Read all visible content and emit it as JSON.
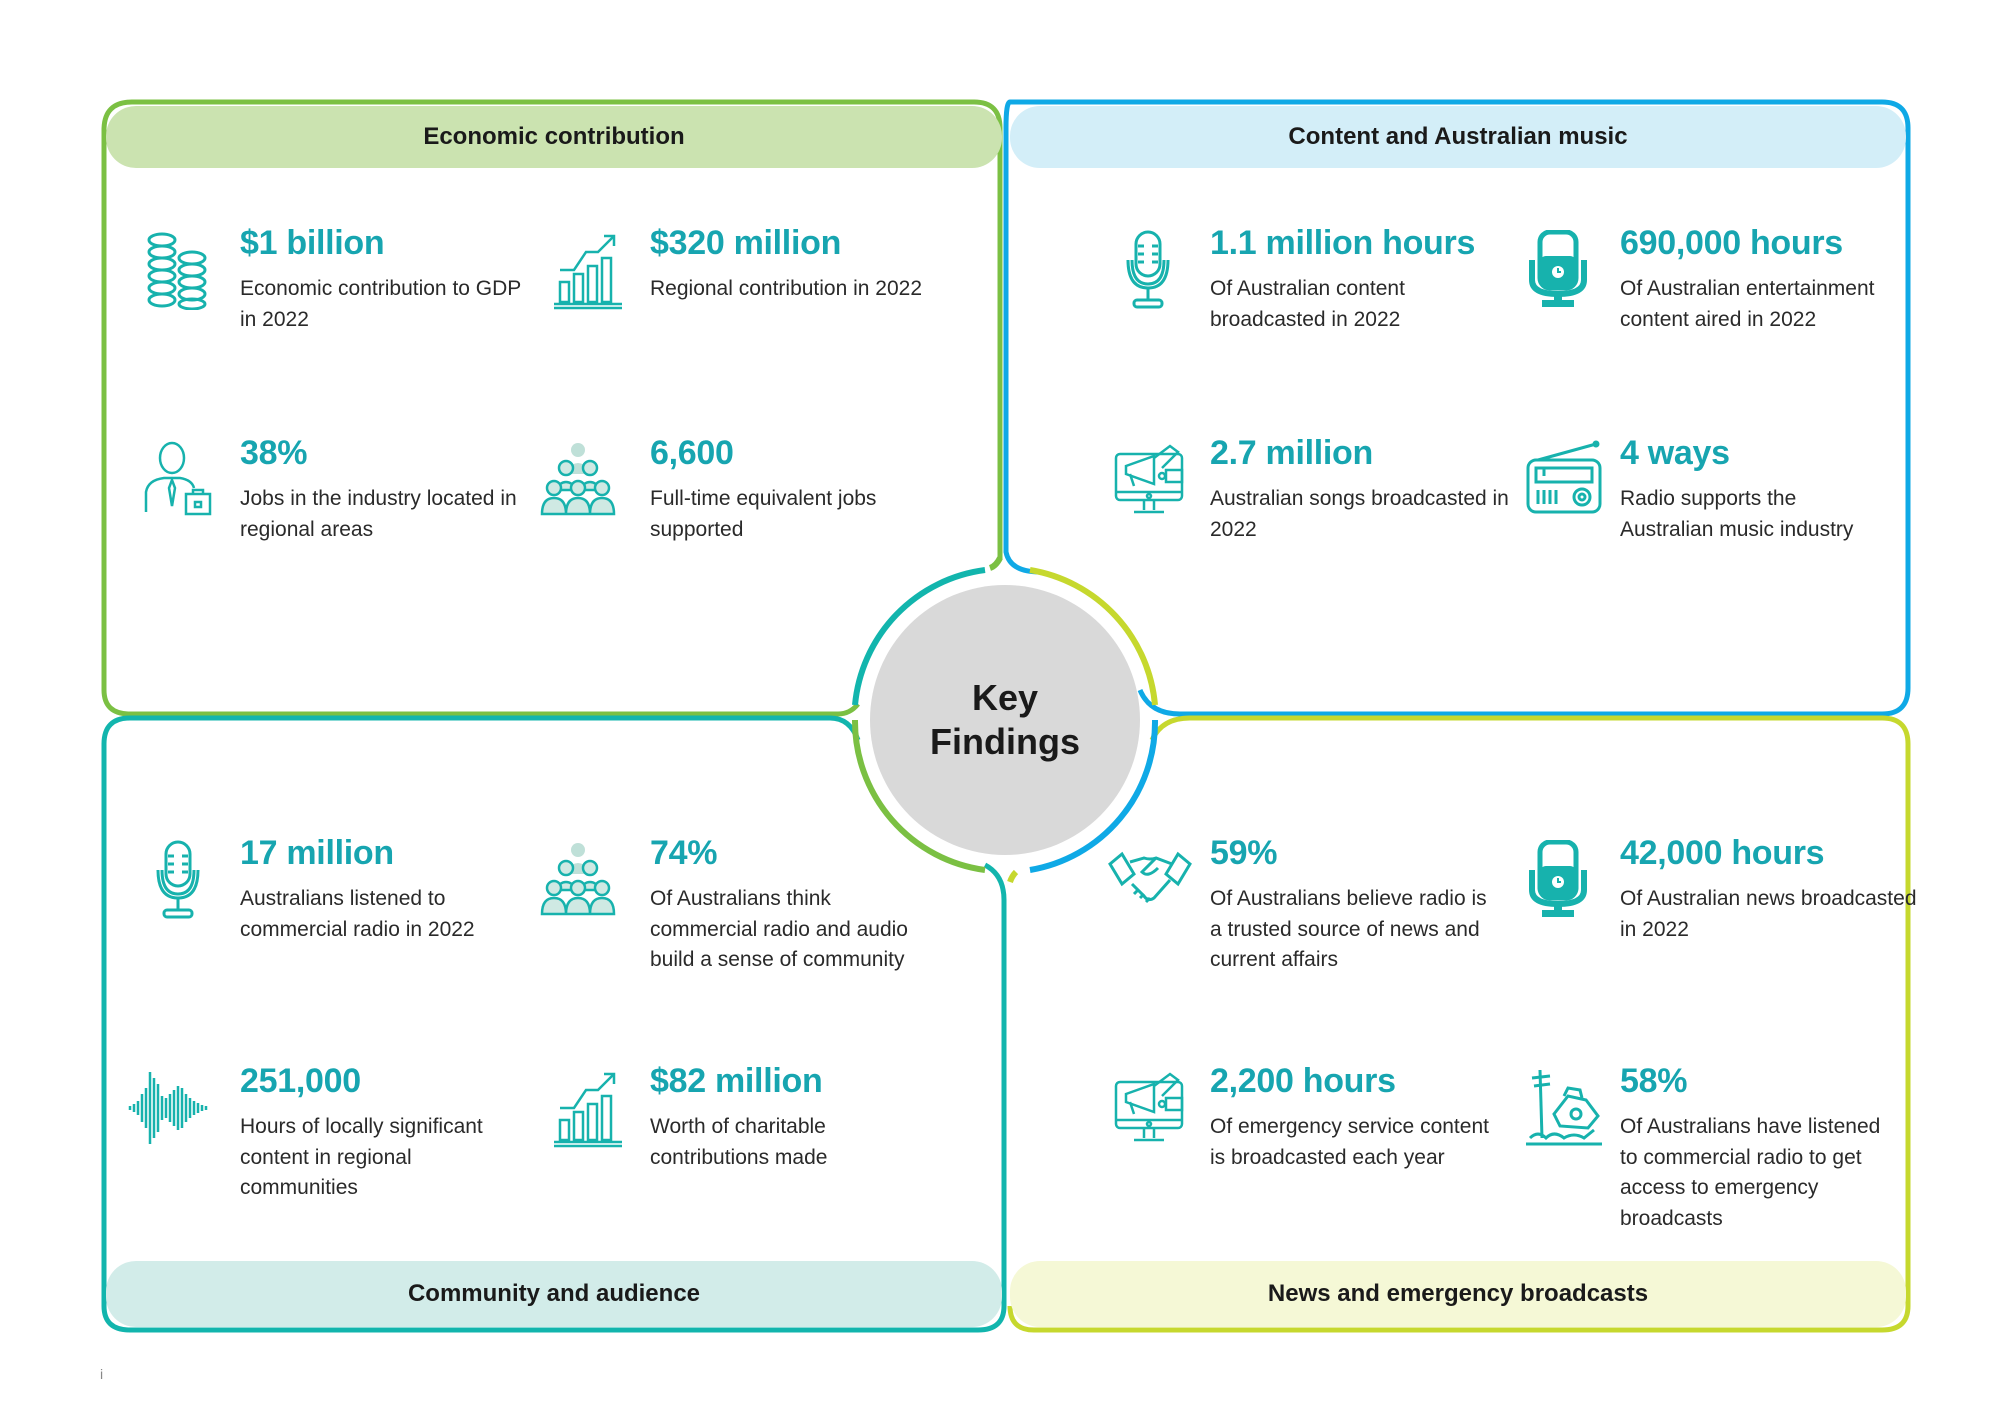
{
  "center": {
    "line1": "Key",
    "line2": "Findings"
  },
  "colors": {
    "economic": "#7bc043",
    "content": "#0fa9e6",
    "community": "#12b5ad",
    "news": "#c6d82e",
    "accent_text": "#17a5b0"
  },
  "sections": {
    "economic": {
      "title": "Economic contribution",
      "stats": [
        {
          "icon": "coins-stack-icon",
          "value": "$1 billion",
          "desc": "Economic contribution to GDP in 2022"
        },
        {
          "icon": "growth-chart-icon",
          "value": "$320 million",
          "desc": "Regional contribution in 2022"
        },
        {
          "icon": "businessman-icon",
          "value": "38%",
          "desc": "Jobs in the industry located in regional areas"
        },
        {
          "icon": "people-group-icon",
          "value": "6,600",
          "desc": "Full-time equivalent jobs supported"
        }
      ]
    },
    "content": {
      "title": "Content and Australian music",
      "stats": [
        {
          "icon": "microphone-icon",
          "value": "1.1 million hours",
          "desc": "Of Australian content broadcasted in 2022"
        },
        {
          "icon": "podcast-mic-icon",
          "value": "690,000 hours",
          "desc": "Of Australian entertainment content aired in 2022"
        },
        {
          "icon": "monitor-megaphone-icon",
          "value": "2.7 million",
          "desc": "Australian songs broadcasted in 2022"
        },
        {
          "icon": "radio-icon",
          "value": "4 ways",
          "desc": "Radio supports the Australian music industry"
        }
      ]
    },
    "community": {
      "title": "Community and audience",
      "stats": [
        {
          "icon": "microphone-icon",
          "value": "17 million",
          "desc": "Australians listened to commercial radio in 2022"
        },
        {
          "icon": "people-group-icon",
          "value": "74%",
          "desc": "Of Australians think commercial radio and audio build a sense of community"
        },
        {
          "icon": "sound-wave-icon",
          "value": "251,000",
          "desc": "Hours of locally significant content in regional communities"
        },
        {
          "icon": "growth-chart-icon",
          "value": "$82 million",
          "desc": "Worth of charitable contributions made"
        }
      ]
    },
    "news": {
      "title": "News and emergency broadcasts",
      "stats": [
        {
          "icon": "handshake-icon",
          "value": "59%",
          "desc": "Of Australians believe radio is a trusted source of news and current affairs"
        },
        {
          "icon": "podcast-mic-icon",
          "value": "42,000 hours",
          "desc": "Of Australian news broadcasted in 2022"
        },
        {
          "icon": "monitor-megaphone-icon",
          "value": "2,200 hours",
          "desc": "Of emergency service content is broadcasted each year"
        },
        {
          "icon": "disaster-house-icon",
          "value": "58%",
          "desc": "Of Australians have listened to commercial radio to get access to emergency broadcasts"
        }
      ]
    }
  },
  "page_number": "i"
}
